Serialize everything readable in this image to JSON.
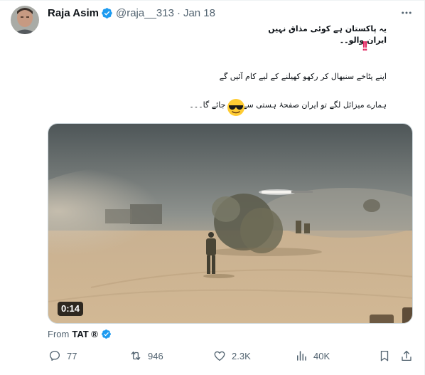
{
  "tweet": {
    "display_name": "Raja Asim",
    "handle": "@raja__313",
    "separator": "·",
    "date": "Jan 18",
    "text_line_1": "یہ پاکستان ہے کوئی مذاق نہیں",
    "text_line_2": "ایران والو۔۔",
    "text_line_2_emoji": "‼️",
    "text_line_3": "اپنے پٹاخے سنبھال کر رکھو کھیلنے کے لیے کام آئیں گے",
    "text_line_4": "ہمارے میزائل لگے تو ایران صفحۂ ہستی سے مٹ جائے گا۔۔۔",
    "text_line_4_emoji": "😎"
  },
  "media": {
    "type": "video",
    "duration": "0:14"
  },
  "attribution": {
    "prefix": "From",
    "source": "TAT ®"
  },
  "actions": {
    "replies": "77",
    "reposts": "946",
    "likes": "2.3K",
    "views": "40K"
  },
  "icons": {
    "verified": "verified-badge-icon",
    "more": "more-options-icon",
    "reply": "reply-icon",
    "repost": "repost-icon",
    "like": "heart-icon",
    "views": "views-chart-icon",
    "bookmark": "bookmark-icon",
    "share": "share-icon"
  },
  "colors": {
    "verified_blue": "#1d9bf0",
    "text_primary": "#0f1419",
    "text_secondary": "#536471",
    "border": "#cfd9de",
    "emphasis_red": "#e0245e"
  }
}
